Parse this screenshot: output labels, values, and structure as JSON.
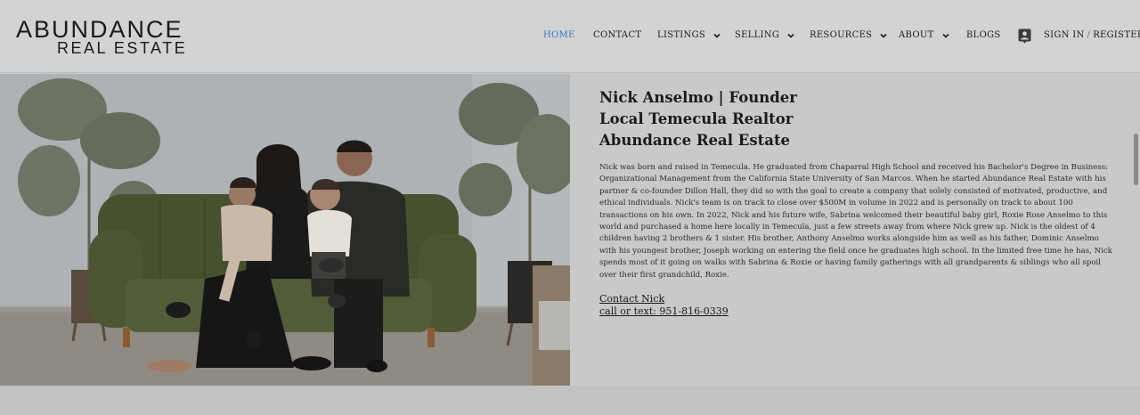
{
  "logo": {
    "line1": "ABUNDANCE",
    "line2": "REAL ESTATE"
  },
  "nav": {
    "items": [
      {
        "label": "HOME",
        "active": true
      },
      {
        "label": "CONTACT"
      },
      {
        "label": "LISTINGS"
      },
      {
        "label": "SELLING"
      },
      {
        "label": "RESOURCES"
      },
      {
        "label": "ABOUT"
      },
      {
        "label": "BLOGS"
      }
    ],
    "sign_in": "SIGN IN",
    "separator": "/",
    "register": "REGISTER",
    "accent_color": "#3a74c4"
  },
  "profile": {
    "title1": "Nick Anselmo | Founder",
    "title2": "Local Temecula Realtor",
    "title3": "Abundance Real Estate",
    "bio": "Nick was born and raised in Temecula. He graduated from Chaparral High School and received his Bachelor's Degree in Business: Organizational Management from the California State University of San Marcos. When he started Abundance Real Estate with his partner & co-founder Dillon Hall, they did so with the goal to create a company that solely consisted of motivated, productive, and ethical individuals. Nick's team is on track to close over $500M in volume in 2022 and is personally on track to about 100 transactions on his own. In 2022, Nick and his future wife, Sabrina welcomed their beautiful baby girl, Roxie Rose Anselmo to this world and purchased a home here locally in Temecula, just a few streets away from where Nick grew up. Nick is the oldest of 4 children having 2 brothers & 1 sister. His brother, Anthony Anselmo works alongside him as well as his father, Dominic Anselmo with his youngest brother, Joseph working on entering the field once he graduates high school. In the limited free time he has, Nick spends most of it going on walks with Sabrina & Roxie or having family gatherings with all grandparents & siblings who all spoil over their first grandchild, Roxie.",
    "contact_link": "Contact Nick",
    "phone_link": "call or text: 951-816-0339"
  }
}
